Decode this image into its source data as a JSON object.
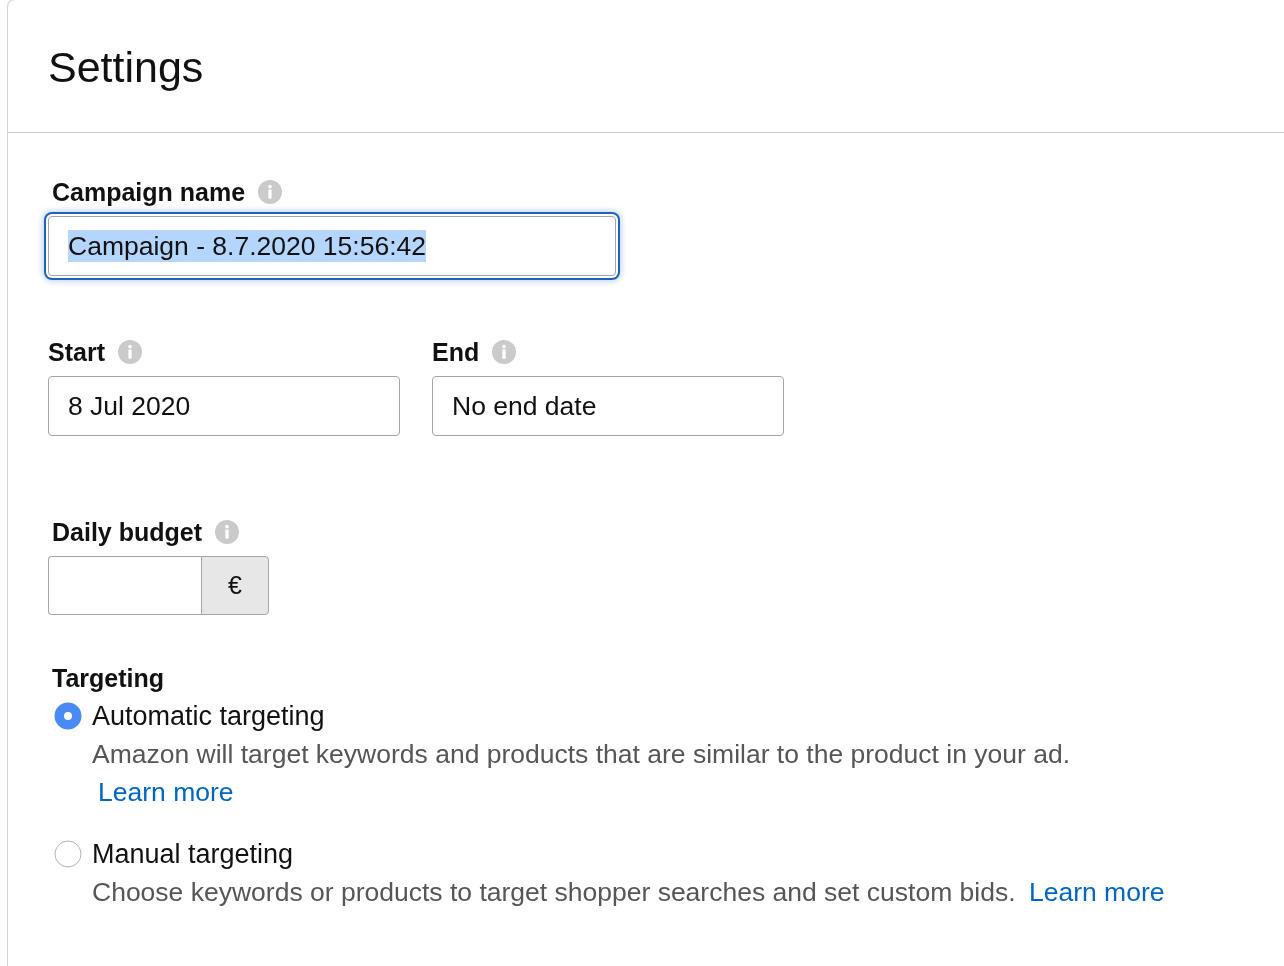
{
  "panel": {
    "title": "Settings"
  },
  "campaign_name": {
    "label": "Campaign name",
    "value": "Campaign - 8.7.2020 15:56:42",
    "focused": true,
    "text_selected": true
  },
  "schedule": [
    {
      "label": "Start",
      "value": "8 Jul 2020"
    },
    {
      "label": "End",
      "value": "No end date"
    }
  ],
  "daily_budget": {
    "label": "Daily budget",
    "currency": "€"
  },
  "targeting": {
    "label": "Targeting",
    "options": [
      {
        "label": "Automatic targeting",
        "description": "Amazon will target keywords and products that are similar to the product in your ad.",
        "link": "Learn more",
        "selected": true
      },
      {
        "label": "Manual targeting",
        "description": "Choose keywords or products to target shopper searches and set custom bids.",
        "link": "Learn more",
        "selected": false
      }
    ]
  }
}
